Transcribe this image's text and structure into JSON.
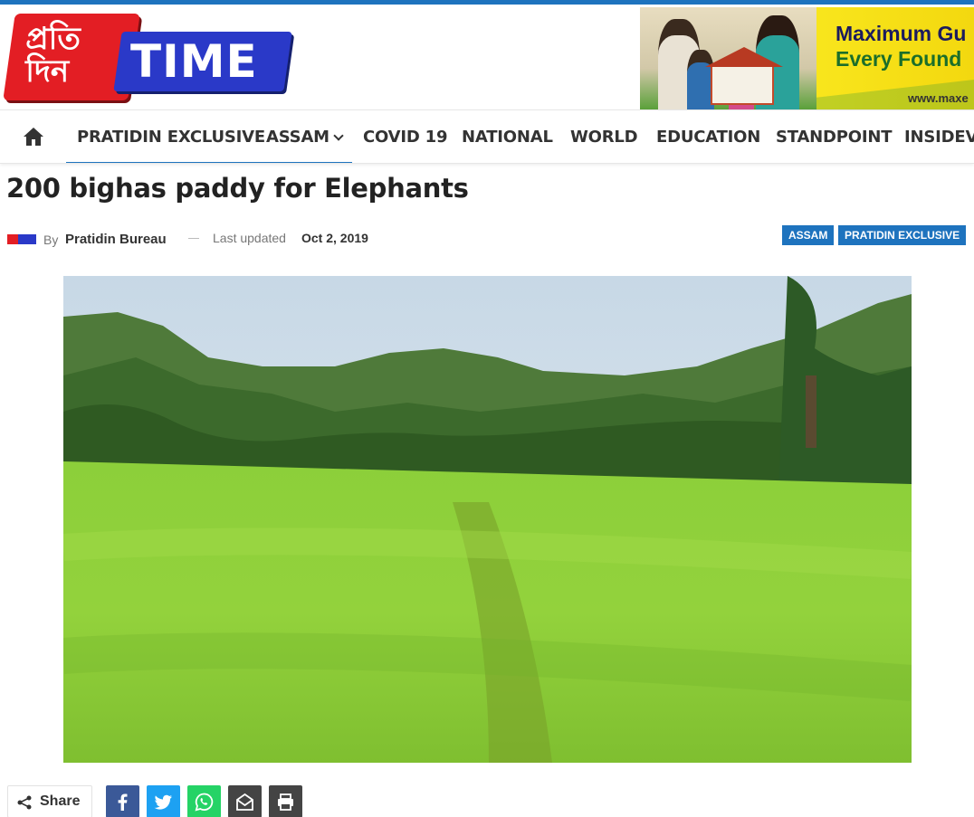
{
  "header": {
    "logo": {
      "left_text": "প্ৰতি দিন",
      "right_text": "TIME"
    },
    "ad": {
      "line1": "Maximum Gu",
      "line2": "Every Found",
      "url": "www.maxe"
    }
  },
  "nav": {
    "home_icon": "home-icon",
    "items": [
      {
        "label": "PRATIDIN EXCLUSIVE",
        "active": true
      },
      {
        "label": "ASSAM",
        "active": true,
        "has_dropdown": true
      },
      {
        "label": "COVID 19"
      },
      {
        "label": "NATIONAL"
      },
      {
        "label": "WORLD"
      },
      {
        "label": "EDUCATION"
      },
      {
        "label": "STANDPOINT"
      },
      {
        "label": "INSIDEVI"
      }
    ],
    "accent": "#1e73be"
  },
  "article": {
    "title": "200 bighas paddy for Elephants",
    "by": "By",
    "author": "Pratidin Bureau",
    "last_updated_label": "Last updated",
    "date": "Oct 2, 2019",
    "tags": [
      "ASSAM",
      "PRATIDIN EXCLUSIVE"
    ]
  },
  "share": {
    "label": "Share",
    "buttons": [
      {
        "name": "facebook",
        "icon": "facebook-icon",
        "color": "#3b5998"
      },
      {
        "name": "twitter",
        "icon": "twitter-icon",
        "color": "#1da1f2"
      },
      {
        "name": "whatsapp",
        "icon": "whatsapp-icon",
        "color": "#25d366"
      },
      {
        "name": "email",
        "icon": "email-icon",
        "color": "#444444"
      },
      {
        "name": "print",
        "icon": "print-icon",
        "color": "#444444"
      }
    ]
  }
}
